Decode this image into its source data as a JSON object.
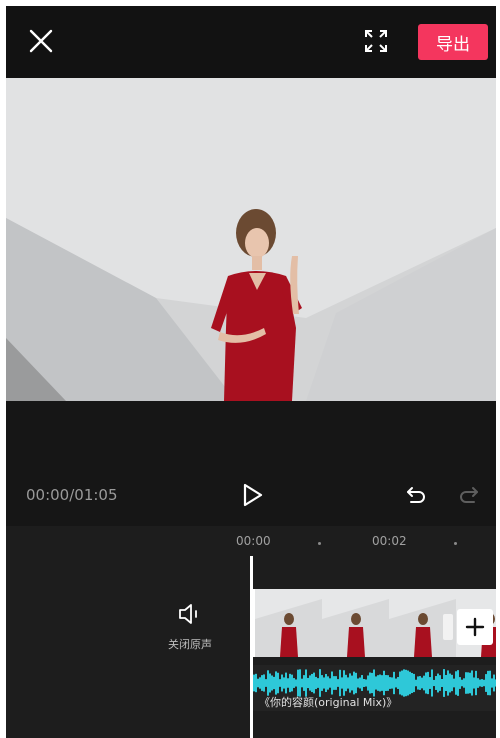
{
  "topbar": {
    "close_icon": "close-icon",
    "fullscreen_icon": "fullscreen-icon",
    "export_label": "导出",
    "export_color": "#f4365e"
  },
  "player": {
    "time_readout": "00:00/01:05",
    "play_icon": "play-icon",
    "undo_icon": "undo-icon",
    "redo_icon": "redo-icon"
  },
  "timeline": {
    "ruler": [
      "00:00",
      "00:02"
    ],
    "mute_label": "关闭原声",
    "mute_icon": "speaker-icon",
    "add_icon": "plus-icon",
    "audio_title": "《你的容颜(original Mix)》",
    "audio_color": "#2ec8d8"
  }
}
